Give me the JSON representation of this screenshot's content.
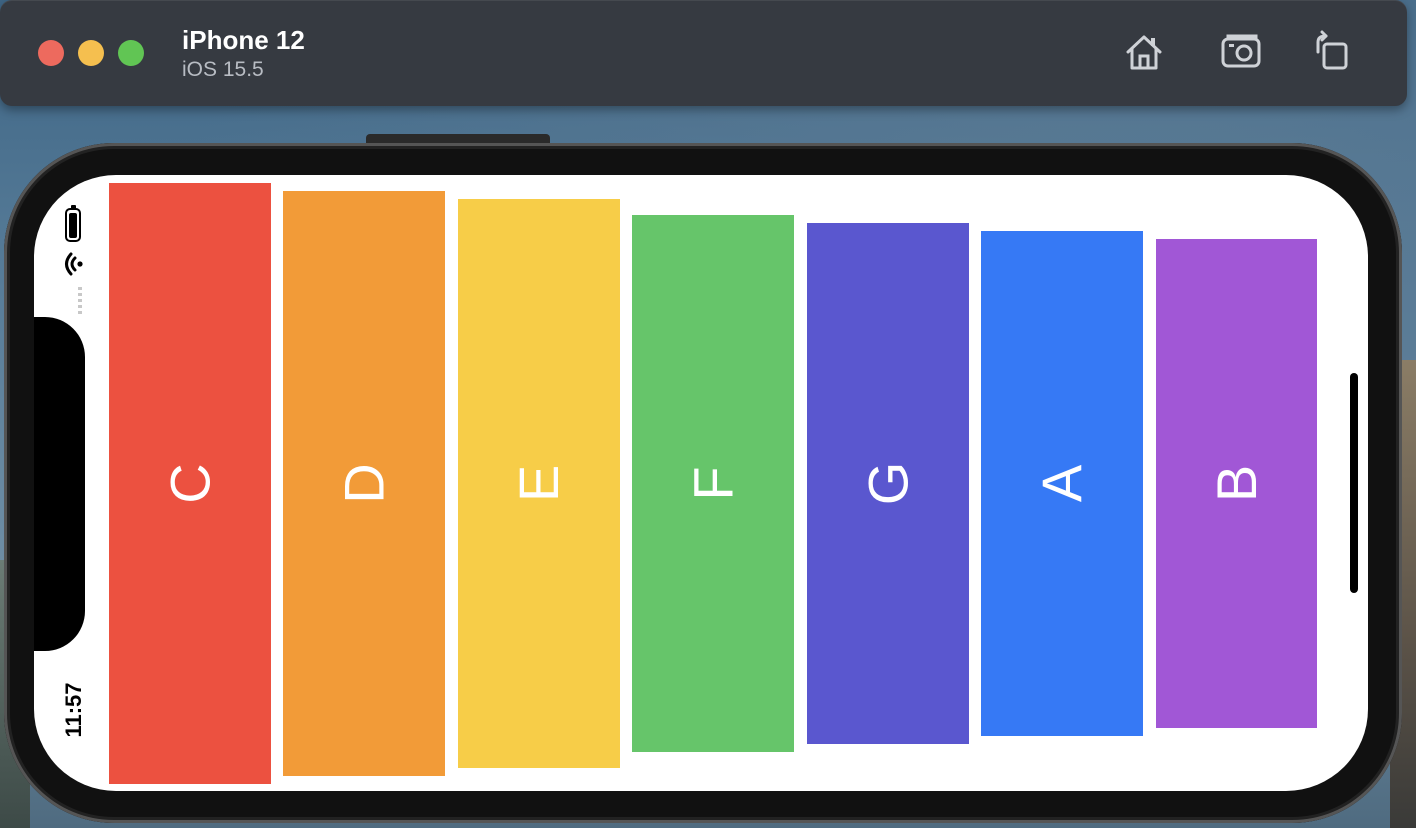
{
  "window": {
    "device_name": "iPhone 12",
    "os_version": "iOS 15.5",
    "toolbar": {
      "home_icon": "home-icon",
      "screenshot_icon": "camera-icon",
      "rotate_icon": "rotate-icon"
    }
  },
  "status_bar": {
    "time": "11:57",
    "battery_icon": "battery-icon",
    "wifi_icon": "wifi-icon"
  },
  "keys": [
    {
      "label": "C",
      "color": "#ec5140"
    },
    {
      "label": "D",
      "color": "#f29b38"
    },
    {
      "label": "E",
      "color": "#f7cd48"
    },
    {
      "label": "F",
      "color": "#66c56a"
    },
    {
      "label": "G",
      "color": "#5a57cf"
    },
    {
      "label": "A",
      "color": "#3679f5"
    },
    {
      "label": "B",
      "color": "#a157d6"
    }
  ]
}
